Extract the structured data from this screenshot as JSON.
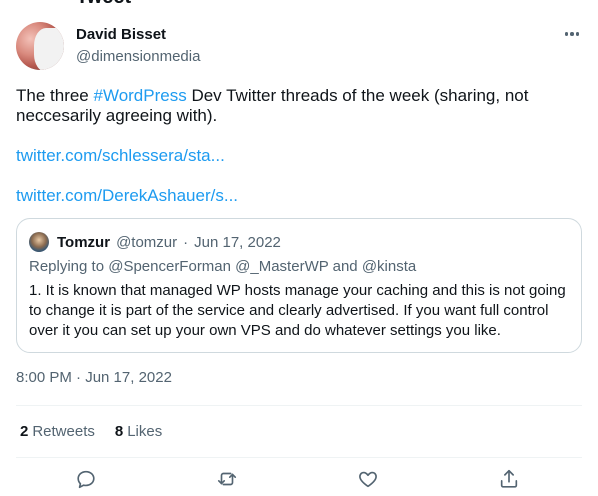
{
  "header": {
    "partial_title": "Tweet"
  },
  "author": {
    "display_name": "David Bisset",
    "handle": "@dimensionmedia"
  },
  "tweet": {
    "text_before": "The three ",
    "hashtag": "#WordPress",
    "text_after": " Dev Twitter threads of the week (sharing, not neccesarily agreeing with).",
    "links": [
      "twitter.com/schlessera/sta...",
      "twitter.com/DerekAshauer/s..."
    ]
  },
  "quoted_tweet": {
    "display_name": "Tomzur",
    "handle": "@tomzur",
    "separator": "·",
    "date": "Jun 17, 2022",
    "replying_to": "Replying to @SpencerForman @_MasterWP and @kinsta",
    "body": "1. It is known that managed WP hosts manage your caching and this is not going to change it is part of the service and clearly advertised. If you want full control over it you can set up your own VPS and do whatever settings you like."
  },
  "meta": {
    "timestamp": "8:00 PM · Jun 17, 2022"
  },
  "stats": {
    "retweets_count": "2",
    "retweets_label": "Retweets",
    "likes_count": "8",
    "likes_label": "Likes"
  },
  "actions": [
    "reply-icon",
    "retweet-icon",
    "like-icon",
    "share-icon"
  ],
  "colors": {
    "accent": "#1d9bf0",
    "text": "#0f1419",
    "muted": "#536471",
    "border": "#cfd9de"
  }
}
